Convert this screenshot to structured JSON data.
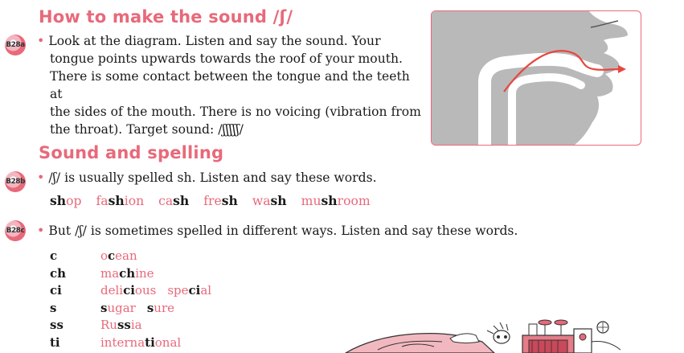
{
  "section1": {
    "heading": "How to make the sound /ʃ/",
    "track": "B28a",
    "text_lines": [
      "Look at the diagram. Listen and say the sound. Your",
      "tongue points upwards towards the roof of your mouth.",
      "There is some contact between the tongue and the teeth at",
      "the sides of the mouth. There is no voicing (vibration from",
      "the throat). Target sound: /ʃʃʃʃʃ/"
    ]
  },
  "section2": {
    "heading": "Sound and spelling",
    "track_b": "B28b",
    "intro_b": "/ʃ/ is usually spelled sh. Listen and say these words.",
    "words_b": [
      {
        "bold": "sh",
        "rest_before": "",
        "rest_after": "op"
      },
      {
        "bold": "sh",
        "rest_before": "fa",
        "rest_after": "ion"
      },
      {
        "bold": "sh",
        "rest_before": "ca",
        "rest_after": ""
      },
      {
        "bold": "sh",
        "rest_before": "fre",
        "rest_after": ""
      },
      {
        "bold": "sh",
        "rest_before": "wa",
        "rest_after": ""
      },
      {
        "bold": "sh",
        "rest_before": "mu",
        "rest_after": "room"
      }
    ],
    "track_c": "B28c",
    "intro_c": "But /ʃ/ is sometimes spelled in different ways. Listen and say these words.",
    "spellings": [
      {
        "key": "c",
        "words": [
          {
            "pre": "o",
            "bold": "c",
            "post": "ean"
          }
        ]
      },
      {
        "key": "ch",
        "words": [
          {
            "pre": "ma",
            "bold": "ch",
            "post": "ine"
          }
        ]
      },
      {
        "key": "ci",
        "words": [
          {
            "pre": "deli",
            "bold": "ci",
            "post": "ous"
          },
          {
            "pre": "spe",
            "bold": "ci",
            "post": "al"
          }
        ]
      },
      {
        "key": "s",
        "words": [
          {
            "pre": "",
            "bold": "s",
            "post": "ugar"
          },
          {
            "pre": "",
            "bold": "s",
            "post": "ure"
          }
        ]
      },
      {
        "key": "ss",
        "words": [
          {
            "pre": "Ru",
            "bold": "ss",
            "post": "ia"
          }
        ]
      },
      {
        "key": "ti",
        "words": [
          {
            "pre": "interna",
            "bold": "ti",
            "post": "onal"
          }
        ]
      }
    ]
  },
  "colors": {
    "accent": "#e8697a",
    "diagram_gray": "#b9b9b9",
    "text": "#1a1a1a"
  },
  "icons": {
    "audio": "cd-icon"
  }
}
